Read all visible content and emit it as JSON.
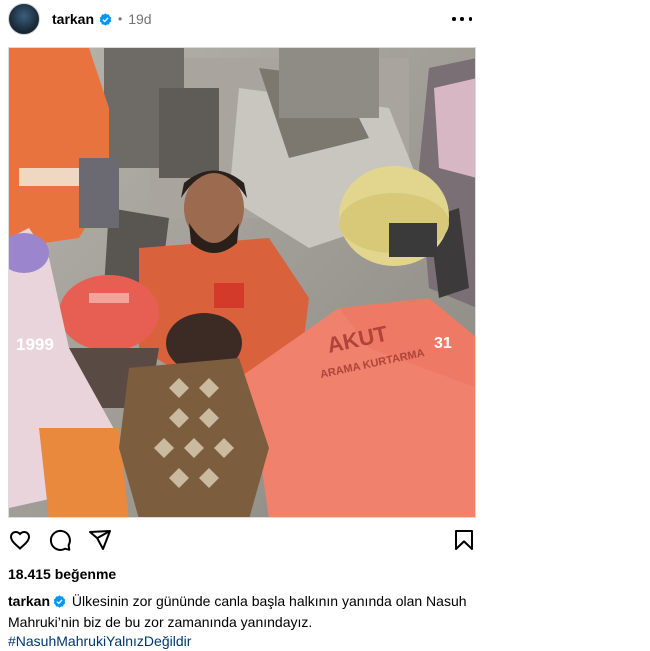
{
  "post": {
    "username": "tarkan",
    "separator": "•",
    "time": "19d",
    "likes": "18.415 beğenme",
    "caption_text": "Ülkesinin zor gününde canla başla halkının yanında olan Nasuh Mahruki’nin biz de bu zor zamanında yanındayız.",
    "hashtag": "#NasuhMahrukiYalnızDeğildir"
  },
  "photo": {
    "year_overlay": "1999",
    "jacket_text_top": "AKUT",
    "jacket_number": "31",
    "jacket_text_bottom": "ARAMA KURTARMA"
  },
  "icons": {
    "like": "heart-icon",
    "comment": "comment-icon",
    "share": "share-icon",
    "save": "bookmark-icon",
    "more": "more-options-icon",
    "verified": "verified-badge-icon"
  },
  "colors": {
    "verified_blue": "#0095f6",
    "hashtag": "#00376b",
    "secondary_text": "#737373"
  }
}
